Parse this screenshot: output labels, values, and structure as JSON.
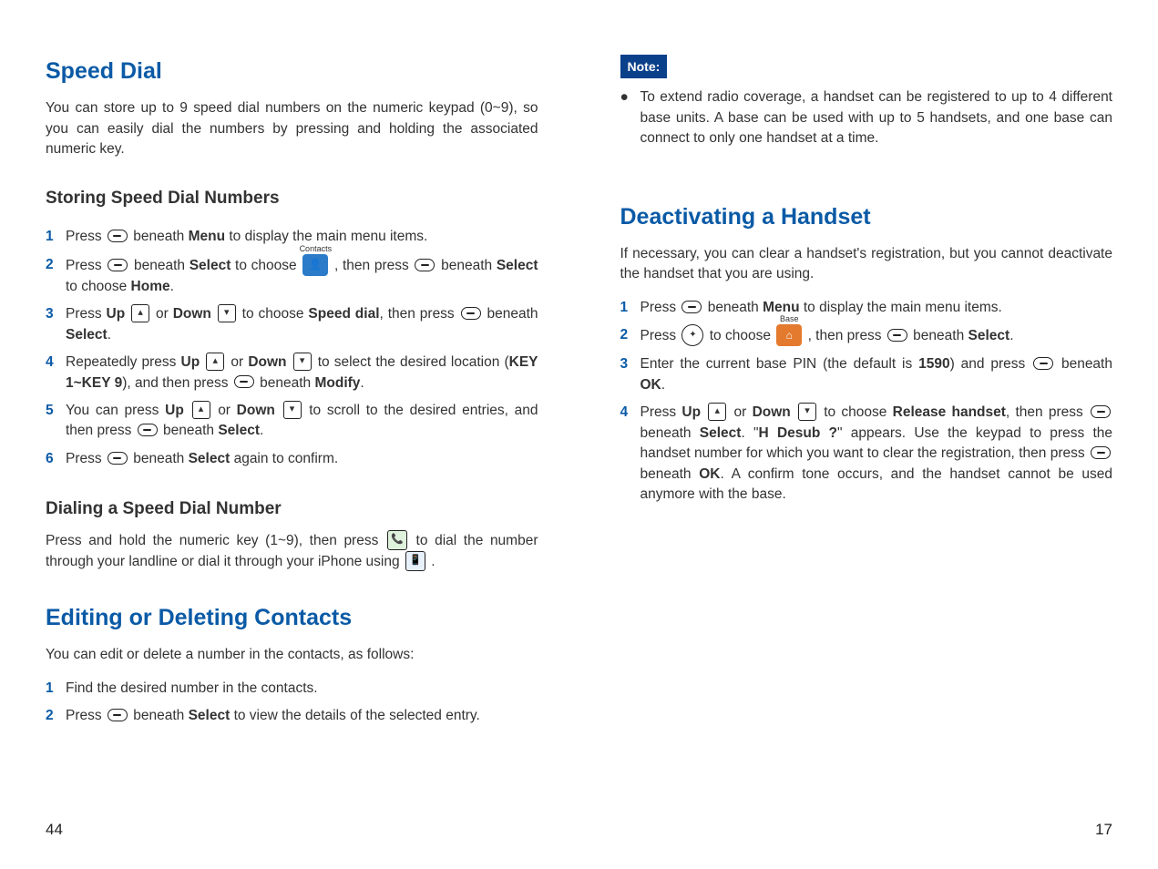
{
  "left": {
    "h1_speed": "Speed Dial",
    "intro_speed": "You can store up to 9 speed dial numbers on the numeric keypad (0~9), so you can easily dial the numbers by pressing and holding the associated numeric key.",
    "h2_storing": "Storing Speed Dial Numbers",
    "store": {
      "s1a": "Press ",
      "s1b": " beneath ",
      "s1_menu": "Menu",
      "s1c": " to display the main menu items.",
      "s2a": "Press ",
      "s2b": " beneath ",
      "s2_sel": "Select",
      "s2c": " to choose ",
      "contacts_label": "Contacts",
      "s2d": " , then press ",
      "s2e": " beneath ",
      "s2f": " to choose ",
      "s2_home": "Home",
      "s2g": ".",
      "s3a": "Press ",
      "s3_up": "Up",
      "s3b": " or ",
      "s3_down": "Down",
      "s3c": " to choose ",
      "s3_sd": "Speed dial",
      "s3d": ", then press ",
      "s3e": " beneath ",
      "s3_sel": "Select",
      "s3f": ".",
      "s4a": "Repeatedly press ",
      "s4b": " or ",
      "s4c": " to select the desired location (",
      "s4_keys": "KEY 1~KEY 9",
      "s4d": "), and then press ",
      "s4e": " beneath ",
      "s4_mod": "Modify",
      "s4f": ".",
      "s5a": "You can press ",
      "s5b": " or ",
      "s5c": " to scroll to the desired entries, and then press ",
      "s5d": " beneath ",
      "s5_sel": "Select",
      "s5e": ".",
      "s6a": "Press ",
      "s6b": " beneath ",
      "s6_sel": "Select",
      "s6c": " again to confirm."
    },
    "h2_dialing": "Dialing a Speed Dial Number",
    "dial_a": "Press and hold the numeric key (1~9), then press ",
    "dial_b": " to dial the number through your landline or dial it through your iPhone using ",
    "dial_c": " .",
    "h1_edit": "Editing or Deleting Contacts",
    "intro_edit": "You can edit or delete a number in the contacts, as follows:",
    "edit": {
      "e1": "Find the desired number in the contacts.",
      "e2a": "Press ",
      "e2b": " beneath ",
      "e2_sel": "Select",
      "e2c": " to view the details of the selected entry."
    },
    "page": "44"
  },
  "right": {
    "note_label": "Note:",
    "note_text": "To extend radio coverage, a handset can be registered to up to 4 different base units. A base can be used with up to 5 handsets, and one base can connect to only one handset at a time.",
    "h1_deact": "Deactivating a Handset",
    "intro_deact": "If necessary, you can clear a handset's registration, but you cannot deactivate the handset that you are using.",
    "d": {
      "d1a": "Press ",
      "d1b": " beneath ",
      "d1_menu": "Menu",
      "d1c": " to display the main menu items.",
      "d2a": "Press ",
      "d2b": " to choose ",
      "base_label": "Base",
      "d2c": " , then press ",
      "d2d": " beneath ",
      "d2_sel": "Select",
      "d2e": ".",
      "d3a": "Enter the current base PIN (the default is ",
      "d3_pin": "1590",
      "d3b": ") and press ",
      "d3c": " beneath ",
      "d3_ok": "OK",
      "d3d": ".",
      "d4a": "Press ",
      "d4_up": "Up",
      "d4b": " or ",
      "d4_down": "Down",
      "d4c": " to choose ",
      "d4_rh": "Release handset",
      "d4d": ", then press ",
      "d4e": " beneath ",
      "d4_sel": "Select",
      "d4f": ". \"",
      "d4_hd": "H Desub ?",
      "d4g": "\" appears. Use the keypad to press the handset number for which you want to clear the registration, then press ",
      "d4h": " beneath ",
      "d4_ok": "OK",
      "d4i": ". A confirm tone occurs, and the handset cannot be used anymore with the base."
    },
    "page": "17"
  }
}
